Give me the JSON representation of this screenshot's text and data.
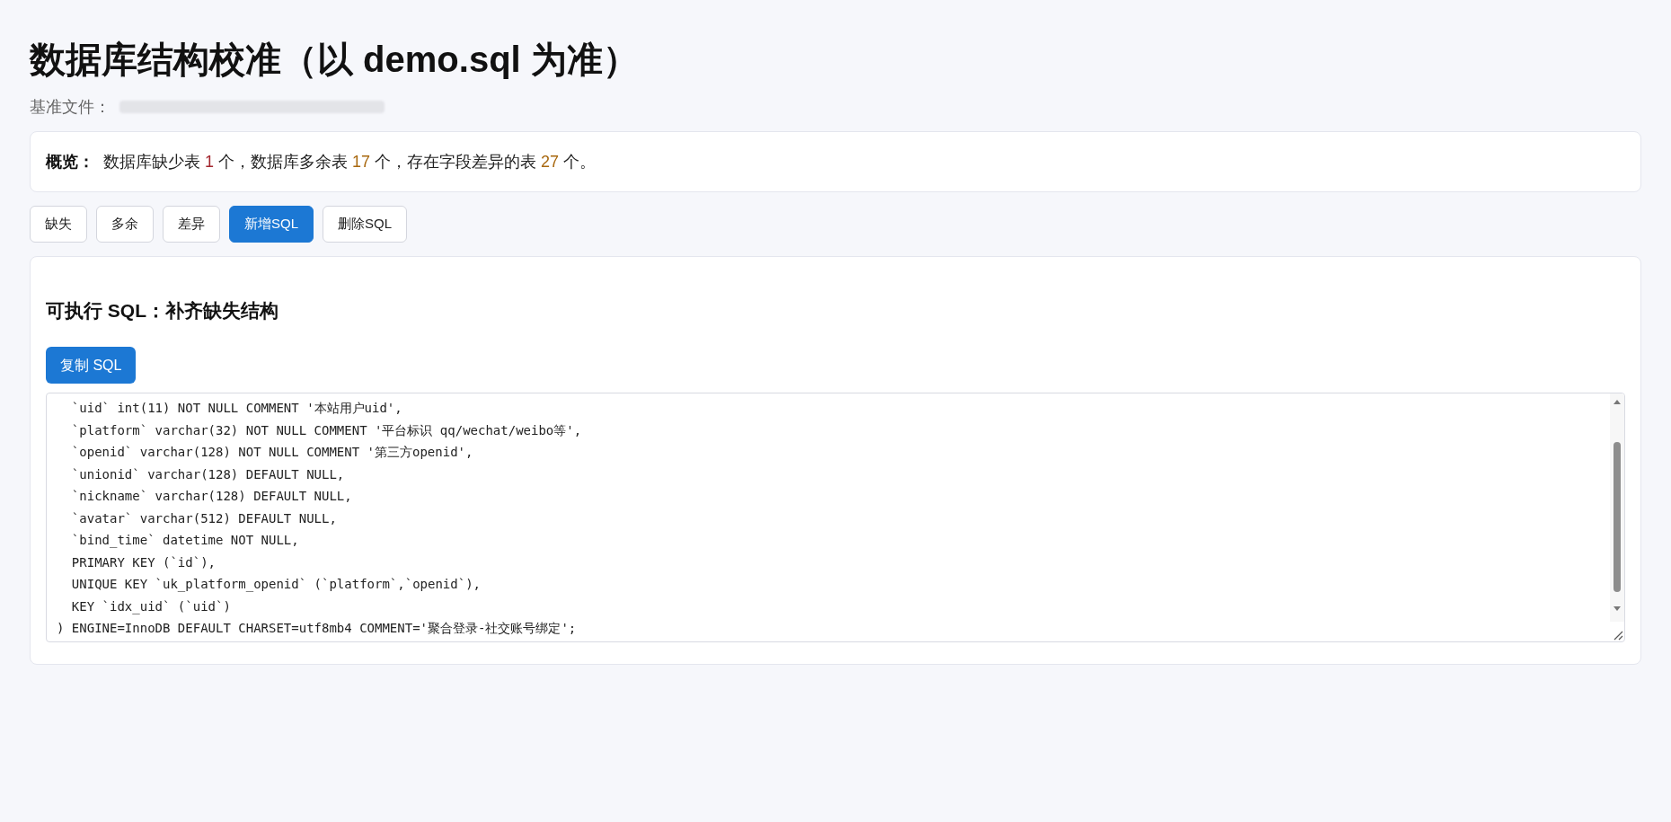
{
  "title": "数据库结构校准（以 demo.sql 为准）",
  "basis": {
    "label": "基准文件："
  },
  "summary": {
    "label": "概览：",
    "parts": [
      {
        "kind": "text",
        "text": "数据库缺少表 "
      },
      {
        "kind": "number",
        "text": "1",
        "color": "#a3262e"
      },
      {
        "kind": "text",
        "text": " 个，数据库多余表 "
      },
      {
        "kind": "number",
        "text": "17",
        "color": "#a8680f"
      },
      {
        "kind": "text",
        "text": " 个，存在字段差异的表 "
      },
      {
        "kind": "number",
        "text": "27",
        "color": "#a8680f"
      },
      {
        "kind": "text",
        "text": " 个。"
      }
    ]
  },
  "tabs": [
    {
      "label": "缺失",
      "selected": false
    },
    {
      "label": "多余",
      "selected": false
    },
    {
      "label": "差异",
      "selected": false
    },
    {
      "label": "新增SQL",
      "selected": true
    },
    {
      "label": "删除SQL",
      "selected": false
    }
  ],
  "panel": {
    "heading": "可执行 SQL：补齐缺失结构",
    "copy_button": "复制 SQL",
    "code_lines": [
      "  `uid` int(11) NOT NULL COMMENT '本站用户uid',",
      "  `platform` varchar(32) NOT NULL COMMENT '平台标识 qq/wechat/weibo等',",
      "  `openid` varchar(128) NOT NULL COMMENT '第三方openid',",
      "  `unionid` varchar(128) DEFAULT NULL,",
      "  `nickname` varchar(128) DEFAULT NULL,",
      "  `avatar` varchar(512) DEFAULT NULL,",
      "  `bind_time` datetime NOT NULL,",
      "  PRIMARY KEY (`id`),",
      "  UNIQUE KEY `uk_platform_openid` (`platform`,`openid`),",
      "  KEY `idx_uid` (`uid`)",
      ") ENGINE=InnoDB DEFAULT CHARSET=utf8mb4 COMMENT='聚合登录-社交账号绑定';"
    ]
  }
}
